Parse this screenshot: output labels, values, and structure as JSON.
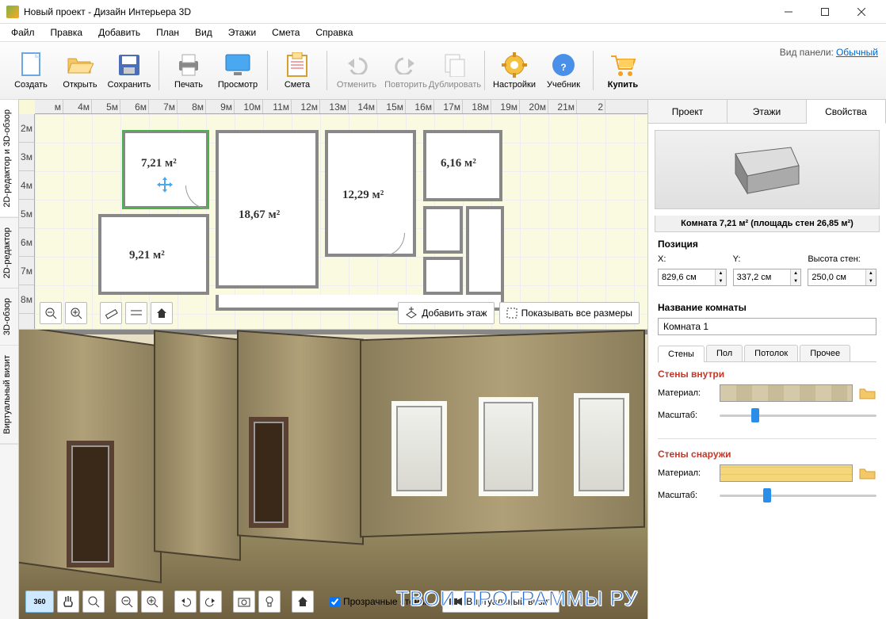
{
  "titlebar": {
    "title": "Новый проект - Дизайн Интерьера 3D"
  },
  "menu": [
    "Файл",
    "Правка",
    "Добавить",
    "План",
    "Вид",
    "Этажи",
    "Смета",
    "Справка"
  ],
  "toolbar": {
    "create": "Создать",
    "open": "Открыть",
    "save": "Сохранить",
    "print": "Печать",
    "preview": "Просмотр",
    "estimate": "Смета",
    "undo": "Отменить",
    "redo": "Повторить",
    "duplicate": "Дублировать",
    "settings": "Настройки",
    "tutorial": "Учебник",
    "buy": "Купить"
  },
  "panel_switch": {
    "label": "Вид панели:",
    "value": "Обычный"
  },
  "lefttabs": {
    "editor2d3d": "2D-редактор и 3D-обзор",
    "editor2d": "2D-редактор",
    "view3d": "3D-обзор",
    "virtual": "Виртуальный визит"
  },
  "ruler_h": [
    "м",
    "4м",
    "5м",
    "6м",
    "7м",
    "8м",
    "9м",
    "10м",
    "11м",
    "12м",
    "13м",
    "14м",
    "15м",
    "16м",
    "17м",
    "18м",
    "19м",
    "20м",
    "21м",
    "2"
  ],
  "ruler_v": [
    "2м",
    "3м",
    "4м",
    "5м",
    "6м",
    "7м",
    "8м"
  ],
  "rooms": {
    "r1": "7,21 м²",
    "r2": "6,16 м²",
    "r3": "18,67 м²",
    "r4": "12,29 м²",
    "r5": "9,21 м²"
  },
  "view2d_btns": {
    "add_floor": "Добавить этаж",
    "show_sizes": "Показывать все размеры"
  },
  "view3d_btns": {
    "transparent_walls": "Прозрачные стены",
    "virtual_visit": "Виртуальный визит"
  },
  "rightpanel": {
    "tabs": {
      "project": "Проект",
      "floors": "Этажи",
      "props": "Свойства"
    },
    "preview_label": "Комната 7,21 м²  (площадь стен 26,85 м²)",
    "position": {
      "title": "Позиция",
      "x_label": "X:",
      "y_label": "Y:",
      "h_label": "Высота стен:",
      "x": "829,6 см",
      "y": "337,2 см",
      "h": "250,0 см"
    },
    "room_name": {
      "title": "Название комнаты",
      "value": "Комната 1"
    },
    "subtabs": {
      "walls": "Стены",
      "floor": "Пол",
      "ceiling": "Потолок",
      "other": "Прочее"
    },
    "walls_in": {
      "title": "Стены внутри",
      "material": "Материал:",
      "scale": "Масштаб:"
    },
    "walls_out": {
      "title": "Стены снаружи",
      "material": "Материал:",
      "scale": "Масштаб:"
    }
  },
  "watermark": "ТВОИ ПРОГРАММЫ РУ"
}
